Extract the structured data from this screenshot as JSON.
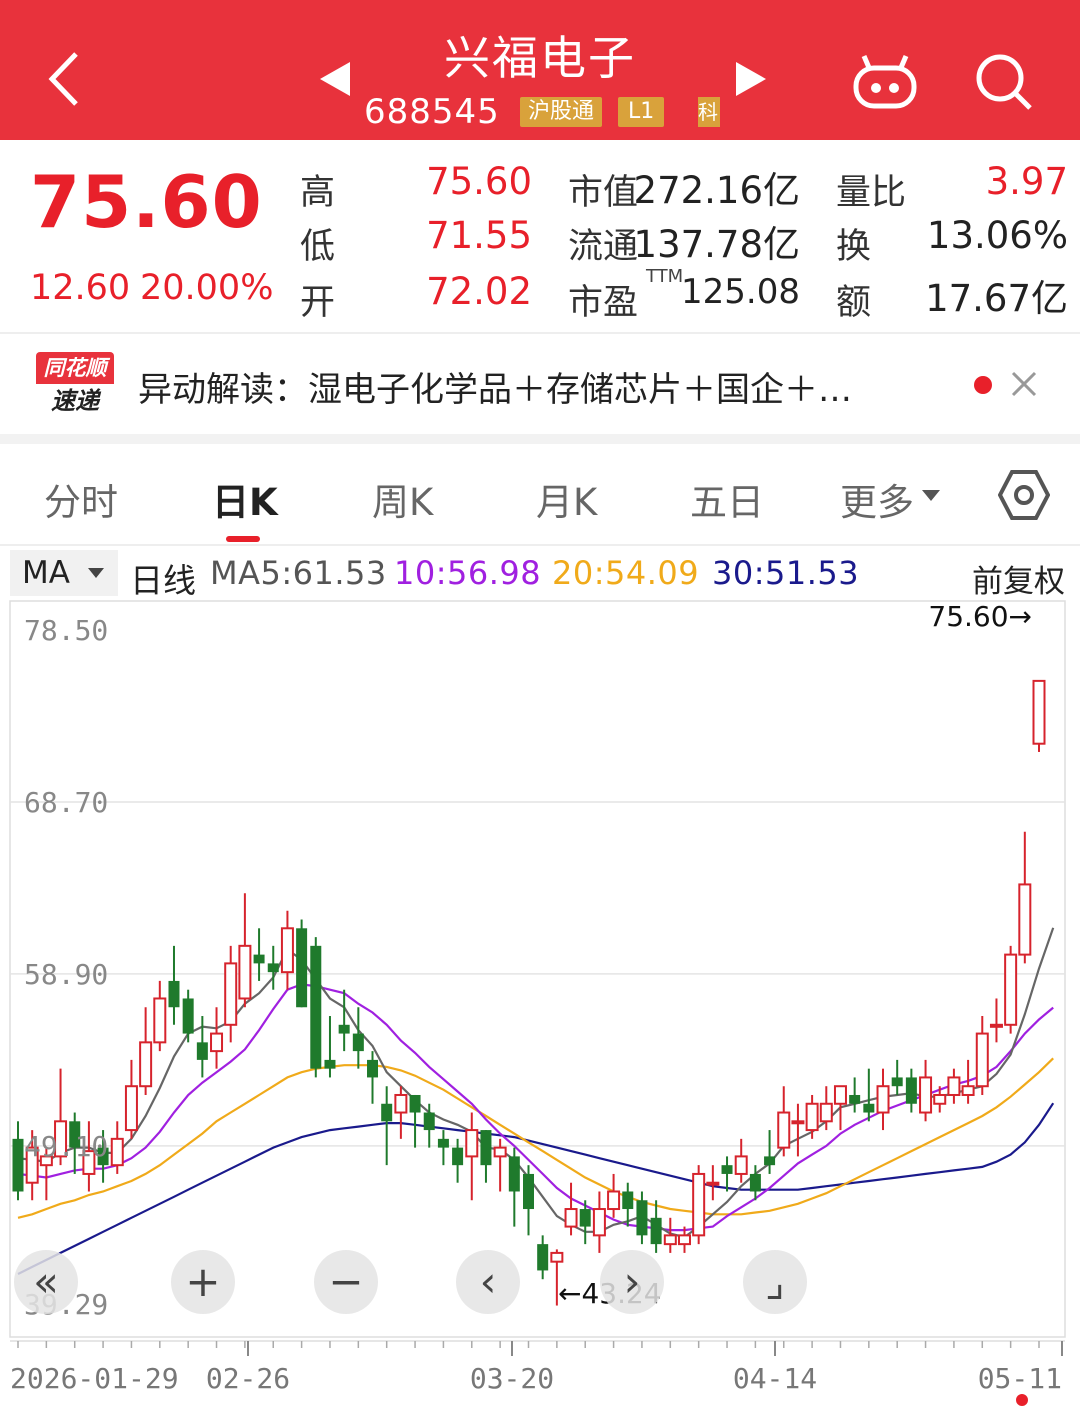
{
  "header": {
    "title": "兴福电子",
    "code": "688545",
    "tag_hk": "沪股通",
    "tag_l1": "L1",
    "tag_k": "科"
  },
  "quote": {
    "price": "75.60",
    "change": "12.60",
    "change_pct": "20.00%",
    "rows": [
      {
        "l1": "高",
        "v1": "75.60",
        "l2": "市值",
        "v2": "272.16亿",
        "l3": "量比",
        "v3": "3.97"
      },
      {
        "l1": "低",
        "v1": "71.55",
        "l2": "流通",
        "v2": "137.78亿",
        "l3": "换",
        "v3": "13.06%"
      },
      {
        "l1": "开",
        "v1": "72.02",
        "l2": "市盈",
        "sup": "TTM",
        "v2": "125.08",
        "l3": "额",
        "v3": "17.67亿"
      }
    ]
  },
  "news": {
    "logo_top": "同花顺",
    "logo_bottom": "速递",
    "text": "异动解读：湿电子化学品＋存储芯片＋国企＋…"
  },
  "tabs": [
    "分时",
    "日K",
    "周K",
    "月K",
    "五日",
    "更多"
  ],
  "ma_bar": {
    "ma_select": "MA",
    "period": "日线",
    "ma5": "MA5:61.53",
    "ma10": "10:56.98",
    "ma20": "20:54.09",
    "ma30": "30:51.53",
    "adjust": "前复权"
  },
  "colors": {
    "up": "#d6232c",
    "down": "#1f7a2c",
    "ma5": "#666666",
    "ma10": "#a020e0",
    "ma20": "#f0aa1a",
    "ma30": "#1a1a8c",
    "header": "#e8323c"
  },
  "chart_data": {
    "type": "candlestick",
    "ylim": [
      39.29,
      78.5
    ],
    "y_ticks": [
      "78.50",
      "68.70",
      "58.90",
      "49.10",
      "39.29"
    ],
    "x_ticks": [
      "2026-01-29",
      "02-26",
      "03-20",
      "04-14",
      "05-11"
    ],
    "max_marker": "75.60→",
    "min_marker": "←43.24",
    "candles": [
      [
        49.5,
        46.5,
        50.5,
        46.0
      ],
      [
        47.0,
        49.0,
        50.0,
        46.0
      ],
      [
        48.0,
        48.5,
        49.0,
        46.0
      ],
      [
        48.5,
        50.5,
        53.5,
        48.0
      ],
      [
        50.5,
        49.0,
        51.0,
        47.5
      ],
      [
        47.5,
        48.8,
        50.5,
        46.5
      ],
      [
        49.0,
        48.0,
        50.0,
        47.0
      ],
      [
        48.0,
        49.5,
        50.5,
        47.5
      ],
      [
        50.0,
        52.5,
        54.0,
        49.5
      ],
      [
        52.5,
        55.0,
        57.0,
        52.0
      ],
      [
        55.0,
        57.5,
        58.5,
        54.5
      ],
      [
        58.5,
        57.0,
        60.5,
        56.0
      ],
      [
        57.5,
        55.5,
        58.0,
        55.0
      ],
      [
        55.0,
        54.0,
        56.5,
        53.0
      ],
      [
        54.5,
        55.5,
        57.0,
        53.5
      ],
      [
        56.0,
        59.5,
        60.5,
        55.0
      ],
      [
        57.5,
        60.5,
        63.5,
        57.0
      ],
      [
        60.0,
        59.5,
        61.5,
        58.5
      ],
      [
        59.5,
        59.0,
        60.5,
        58.0
      ],
      [
        59.0,
        61.5,
        62.5,
        58.0
      ],
      [
        61.5,
        57.0,
        62.0,
        57.0
      ],
      [
        60.5,
        53.5,
        61.0,
        53.0
      ],
      [
        54.0,
        53.5,
        56.5,
        53.0
      ],
      [
        56.0,
        55.5,
        58.0,
        54.5
      ],
      [
        55.5,
        54.5,
        57.0,
        53.5
      ],
      [
        54.0,
        53.0,
        54.5,
        51.5
      ],
      [
        51.5,
        50.5,
        52.5,
        48.0
      ],
      [
        51.0,
        52.0,
        52.5,
        49.5
      ],
      [
        52.0,
        51.0,
        52.0,
        49.0
      ],
      [
        51.0,
        50.0,
        51.5,
        49.0
      ],
      [
        49.5,
        49.0,
        50.0,
        48.0
      ],
      [
        49.0,
        48.0,
        49.5,
        47.0
      ],
      [
        48.5,
        50.0,
        51.0,
        46.0
      ],
      [
        50.0,
        48.0,
        50.0,
        47.0
      ],
      [
        48.5,
        49.0,
        49.5,
        46.5
      ],
      [
        48.5,
        46.5,
        49.0,
        44.5
      ],
      [
        47.5,
        45.5,
        48.0,
        44.0
      ],
      [
        43.5,
        42.0,
        44.0,
        41.5
      ],
      [
        42.5,
        43.0,
        43.2,
        40.0
      ],
      [
        44.5,
        45.5,
        47.0,
        44.0
      ],
      [
        45.5,
        44.5,
        46.0,
        43.5
      ],
      [
        44.0,
        45.5,
        46.5,
        43.0
      ],
      [
        45.5,
        46.5,
        47.5,
        45.0
      ],
      [
        46.5,
        45.5,
        47.0,
        44.5
      ],
      [
        46.0,
        44.0,
        46.5,
        43.5
      ],
      [
        45.0,
        43.5,
        46.0,
        43.0
      ],
      [
        43.5,
        44.0,
        45.0,
        43.0
      ],
      [
        43.5,
        44.0,
        44.5,
        43.0
      ],
      [
        44.0,
        47.5,
        48.0,
        43.5
      ],
      [
        47.0,
        47.0,
        48.0,
        46.0
      ],
      [
        48.0,
        47.5,
        48.5,
        46.5
      ],
      [
        47.5,
        48.5,
        49.5,
        47.0
      ],
      [
        47.5,
        46.5,
        48.0,
        46.0
      ],
      [
        48.5,
        48.0,
        50.0,
        47.5
      ],
      [
        49.0,
        51.0,
        52.5,
        48.5
      ],
      [
        50.5,
        50.5,
        51.5,
        48.5
      ],
      [
        50.0,
        51.5,
        52.0,
        49.5
      ],
      [
        50.5,
        51.5,
        52.5,
        50.0
      ],
      [
        51.5,
        52.5,
        52.5,
        50.0
      ],
      [
        52.0,
        51.5,
        53.0,
        51.0
      ],
      [
        51.5,
        51.0,
        53.5,
        50.5
      ],
      [
        51.0,
        52.5,
        53.5,
        50.0
      ],
      [
        53.0,
        52.5,
        54.0,
        52.0
      ],
      [
        53.0,
        51.5,
        53.5,
        51.0
      ],
      [
        51.0,
        53.0,
        54.0,
        50.5
      ],
      [
        51.5,
        52.0,
        52.5,
        51.0
      ],
      [
        52.0,
        53.0,
        53.5,
        51.5
      ],
      [
        52.0,
        52.5,
        54.0,
        51.5
      ],
      [
        52.5,
        55.5,
        56.5,
        52.0
      ],
      [
        56.0,
        56.0,
        57.5,
        55.0
      ],
      [
        56.0,
        60.0,
        60.5,
        55.5
      ],
      [
        60.0,
        64.0,
        67.0,
        59.5
      ],
      [
        72.02,
        75.6,
        75.6,
        71.55
      ]
    ],
    "ma5": [
      48.4,
      48.3,
      48.2,
      48.7,
      49.0,
      49.0,
      48.7,
      48.7,
      49.5,
      50.8,
      52.4,
      54.2,
      55.5,
      55.9,
      55.8,
      56.2,
      57.2,
      57.8,
      58.7,
      60.3,
      59.7,
      58.6,
      57.5,
      57.0,
      55.7,
      54.8,
      53.3,
      52.5,
      51.7,
      51.0,
      50.6,
      50.3,
      49.9,
      49.0,
      48.9,
      48.3,
      47.3,
      46.2,
      45.1,
      44.6,
      44.2,
      44.2,
      44.6,
      44.8,
      45.1,
      44.6,
      44.1,
      43.9,
      44.5,
      45.2,
      45.9,
      46.8,
      47.5,
      48.1,
      49.1,
      49.5,
      49.9,
      50.5,
      51.3,
      51.5,
      51.7,
      51.9,
      52.0,
      52.1,
      51.9,
      51.9,
      52.1,
      52.3,
      52.5,
      53.2,
      54.3,
      56.6,
      59.2,
      61.53
    ],
    "ma10": [
      47.5,
      47.4,
      47.3,
      47.5,
      47.7,
      47.8,
      47.8,
      48.0,
      48.4,
      49.0,
      49.9,
      51.0,
      52.0,
      52.7,
      53.3,
      53.9,
      54.6,
      55.7,
      56.9,
      58.0,
      58.3,
      58.2,
      58.0,
      57.8,
      57.2,
      56.7,
      56.0,
      55.1,
      54.4,
      53.6,
      52.9,
      52.2,
      51.5,
      50.6,
      49.8,
      49.1,
      48.3,
      47.5,
      46.7,
      46.1,
      45.7,
      45.3,
      44.9,
      44.6,
      44.5,
      44.4,
      44.3,
      44.3,
      44.4,
      44.5,
      45.1,
      45.6,
      46.1,
      46.7,
      47.4,
      48.1,
      48.6,
      49.1,
      49.8,
      50.3,
      50.7,
      51.1,
      51.4,
      51.7,
      52.0,
      52.3,
      52.6,
      52.8,
      53.1,
      53.6,
      54.5,
      55.5,
      56.3,
      56.98
    ],
    "ma20": [
      45.0,
      45.2,
      45.5,
      45.8,
      46.0,
      46.3,
      46.5,
      46.8,
      47.1,
      47.5,
      48.0,
      48.6,
      49.2,
      49.8,
      50.5,
      51.0,
      51.5,
      52.0,
      52.5,
      53.0,
      53.3,
      53.5,
      53.6,
      53.7,
      53.7,
      53.7,
      53.6,
      53.4,
      53.1,
      52.7,
      52.3,
      51.8,
      51.3,
      50.8,
      50.3,
      49.8,
      49.3,
      48.8,
      48.3,
      47.8,
      47.3,
      46.9,
      46.5,
      46.2,
      45.9,
      45.7,
      45.5,
      45.4,
      45.3,
      45.2,
      45.2,
      45.2,
      45.3,
      45.4,
      45.6,
      45.8,
      46.1,
      46.4,
      46.8,
      47.2,
      47.6,
      48.0,
      48.4,
      48.8,
      49.2,
      49.6,
      50.0,
      50.4,
      50.8,
      51.3,
      51.9,
      52.6,
      53.3,
      54.09
    ],
    "ma30": [
      41.8,
      42.2,
      42.6,
      43.0,
      43.4,
      43.8,
      44.2,
      44.6,
      45.0,
      45.4,
      45.8,
      46.2,
      46.6,
      47.0,
      47.4,
      47.8,
      48.2,
      48.6,
      49.0,
      49.3,
      49.6,
      49.8,
      50.0,
      50.1,
      50.2,
      50.3,
      50.4,
      50.4,
      50.3,
      50.2,
      50.1,
      50.0,
      49.9,
      49.8,
      49.7,
      49.6,
      49.4,
      49.2,
      49.0,
      48.8,
      48.6,
      48.4,
      48.2,
      48.0,
      47.8,
      47.6,
      47.4,
      47.2,
      47.0,
      46.8,
      46.7,
      46.6,
      46.6,
      46.6,
      46.6,
      46.6,
      46.7,
      46.8,
      46.9,
      47.0,
      47.1,
      47.2,
      47.3,
      47.4,
      47.5,
      47.6,
      47.7,
      47.8,
      47.9,
      48.2,
      48.6,
      49.3,
      50.3,
      51.53
    ]
  },
  "chart_buttons": [
    "«",
    "+",
    "−",
    "‹",
    "›",
    "⌟"
  ]
}
